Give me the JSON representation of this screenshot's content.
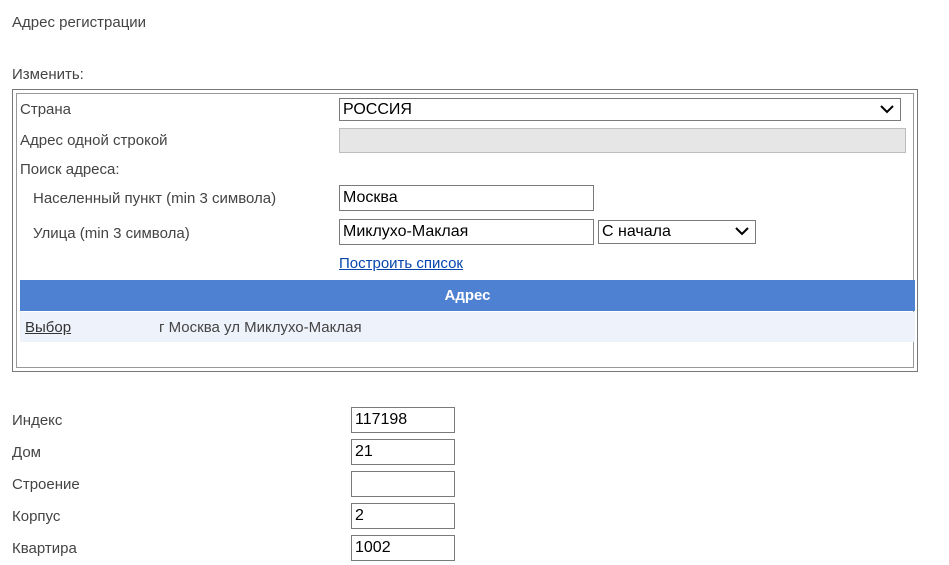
{
  "page": {
    "title": "Адрес регистрации",
    "change_label": "Изменить:"
  },
  "address_form": {
    "country": {
      "label": "Страна",
      "value": "РОССИЯ"
    },
    "one_line": {
      "label": "Адрес одной строкой",
      "value": ""
    },
    "search_label": "Поиск адреса:",
    "locality": {
      "label": "Населенный пункт (min 3 символа)",
      "value": "Москва"
    },
    "street": {
      "label": "Улица (min 3 символа)",
      "value": "Миклухо-Маклая",
      "match_mode": "С начала"
    },
    "build_list_link": "Построить список"
  },
  "results_grid": {
    "header": "Адрес",
    "rows": [
      {
        "action": "Выбор",
        "address": "г Москва ул Миклухо-Маклая"
      }
    ]
  },
  "details": {
    "index": {
      "label": "Индекс",
      "value": "117198"
    },
    "house": {
      "label": "Дом",
      "value": "21"
    },
    "building": {
      "label": "Строение",
      "value": ""
    },
    "block": {
      "label": "Корпус",
      "value": "2"
    },
    "apartment": {
      "label": "Квартира",
      "value": "1002"
    }
  },
  "icons": {
    "dropdown": "chevron-down-icon"
  }
}
